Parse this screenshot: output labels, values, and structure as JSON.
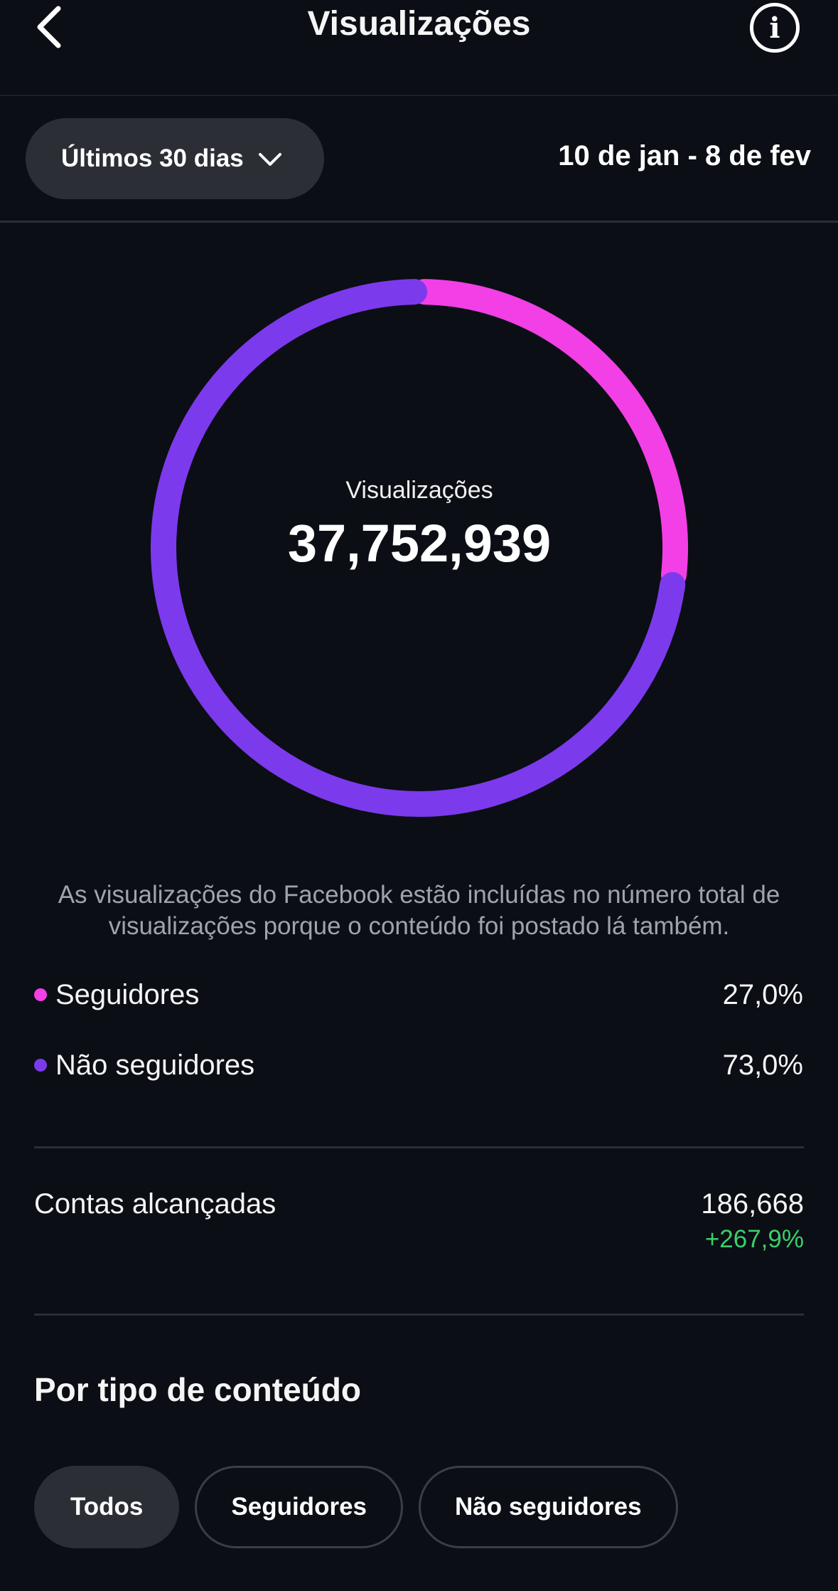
{
  "header": {
    "title": "Visualizações",
    "back_icon": "chevron-left-icon",
    "info_icon": "info-icon",
    "info_glyph": "i"
  },
  "filters": {
    "period_label": "Últimos 30 dias",
    "date_range": "10 de jan - 8 de fev"
  },
  "donut": {
    "label": "Visualizações",
    "total": "37,752,939"
  },
  "chart_data": {
    "type": "pie",
    "categories": [
      "Seguidores",
      "Não seguidores"
    ],
    "values": [
      27.0,
      73.0
    ],
    "colors": [
      "#f23fe6",
      "#7c3aed"
    ]
  },
  "note": "As visualizações do Facebook estão incluídas no número total de visualizações porque o conteúdo foi postado lá também.",
  "legend": [
    {
      "label": "Seguidores",
      "value": "27,0%",
      "color": "#f23fe6"
    },
    {
      "label": "Não seguidores",
      "value": "73,0%",
      "color": "#7c3aed"
    }
  ],
  "reach": {
    "label": "Contas alcançadas",
    "value": "186,668",
    "change": "+267,9%",
    "change_color": "#3bcf6a"
  },
  "content_type": {
    "title": "Por tipo de conteúdo",
    "chips": [
      "Todos",
      "Seguidores",
      "Não seguidores"
    ],
    "active_chip": "Todos"
  }
}
